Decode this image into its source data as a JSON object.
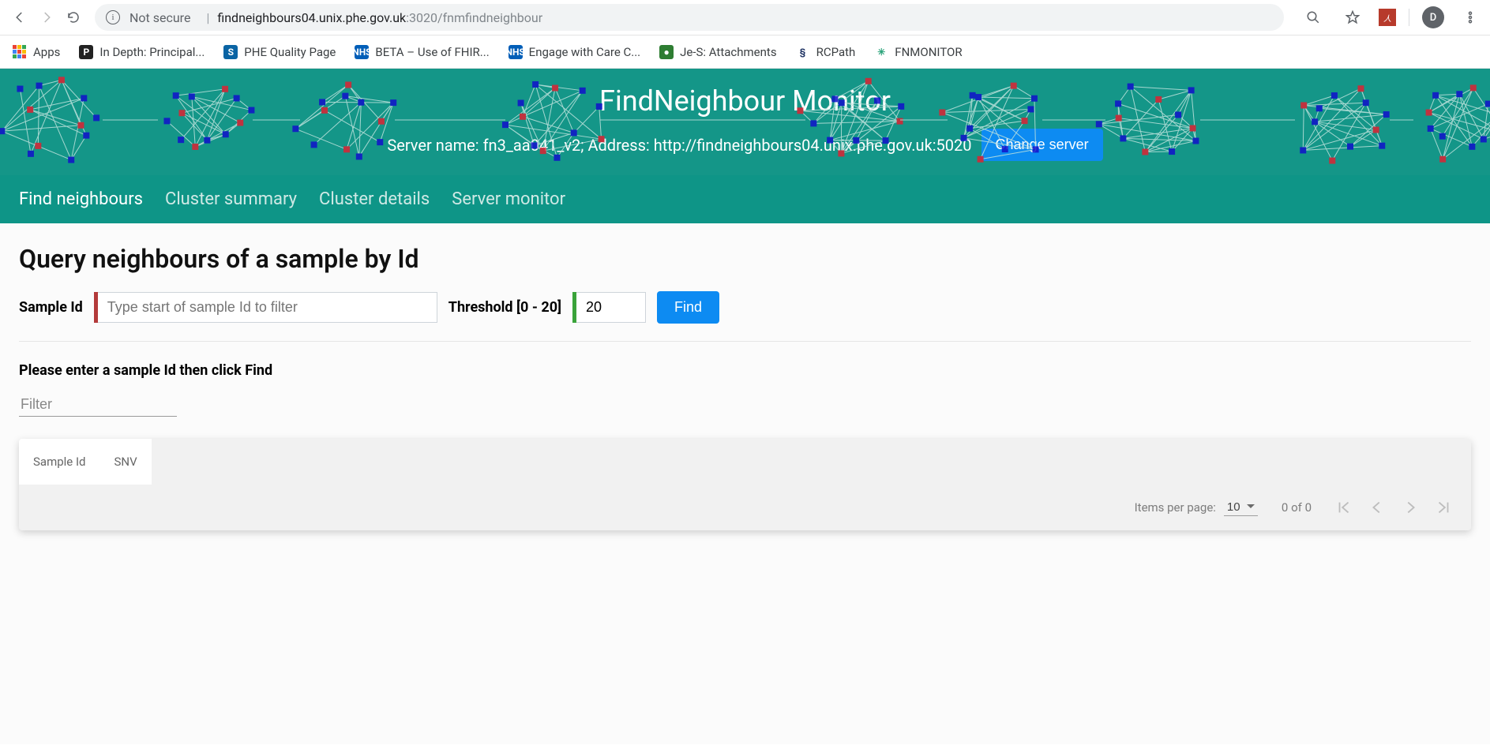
{
  "browser": {
    "not_secure": "Not secure",
    "url_host": "findneighbours04.unix.phe.gov.uk",
    "url_port": ":3020",
    "url_path": "/fnmfindneighbour",
    "avatar_letter": "D"
  },
  "bookmarks": [
    {
      "label": "Apps",
      "icon": "apps"
    },
    {
      "label": "In Depth: Principal...",
      "icon": "P",
      "bg": "#222",
      "fg": "#fff"
    },
    {
      "label": "PHE Quality Page",
      "icon": "S",
      "bg": "#0a64a4",
      "fg": "#fff"
    },
    {
      "label": "BETA – Use of FHIR...",
      "icon": "NHS",
      "bg": "#005eb8",
      "fg": "#fff"
    },
    {
      "label": "Engage with Care C...",
      "icon": "NHS",
      "bg": "#005eb8",
      "fg": "#fff"
    },
    {
      "label": "Je-S: Attachments",
      "icon": "●",
      "bg": "#2e7d32",
      "fg": "#fff"
    },
    {
      "label": "RCPath",
      "icon": "§",
      "bg": "#fff",
      "fg": "#203464"
    },
    {
      "label": "FNMONITOR",
      "icon": "✳",
      "bg": "#fff",
      "fg": "#2aa37a"
    }
  ],
  "header": {
    "title": "FindNeighbour Monitor",
    "info": "Server name: fn3_aa041_v2; Address: http://findneighbours04.unix.phe.gov.uk:5020",
    "change_btn": "Change server"
  },
  "tabs": [
    {
      "label": "Find neighbours",
      "active": true
    },
    {
      "label": "Cluster summary",
      "active": false
    },
    {
      "label": "Cluster details",
      "active": false
    },
    {
      "label": "Server monitor",
      "active": false
    }
  ],
  "main": {
    "heading": "Query neighbours of a sample by Id",
    "sample_label": "Sample Id",
    "sample_placeholder": "Type start of sample Id to filter",
    "threshold_label": "Threshold [0 - 20]",
    "threshold_value": "20",
    "find_btn": "Find",
    "prompt": "Please enter a sample Id then click Find",
    "filter_placeholder": "Filter",
    "columns": {
      "c1": "Sample Id",
      "c2": "SNV"
    },
    "paginator": {
      "ipp_label": "Items per page:",
      "ipp_value": "10",
      "range": "0 of 0"
    }
  }
}
